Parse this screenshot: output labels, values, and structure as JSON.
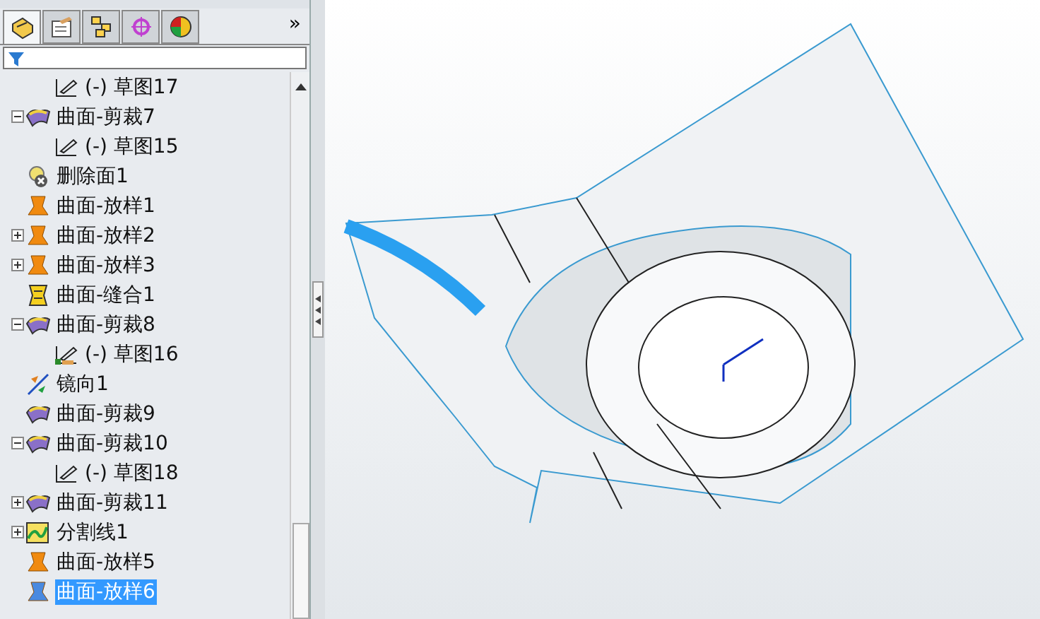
{
  "panel_tabs": [
    {
      "kind": "features",
      "selected": true
    },
    {
      "kind": "properties",
      "selected": false
    },
    {
      "kind": "config",
      "selected": false
    },
    {
      "kind": "dimxpert",
      "selected": false
    },
    {
      "kind": "display",
      "selected": false
    }
  ],
  "more_tabs": "»",
  "tree": [
    {
      "children": [
        {
          "kind": "sketch",
          "label": "(-) 草图17",
          "selected": false
        }
      ]
    },
    {
      "kind": "trim",
      "label": "曲面-剪裁7",
      "expanded": true,
      "selected": false,
      "children": [
        {
          "kind": "sketch",
          "label": "(-) 草图15",
          "selected": false
        }
      ]
    },
    {
      "kind": "delete-face",
      "label": "删除面1",
      "selected": false
    },
    {
      "kind": "loft",
      "label": "曲面-放样1",
      "selected": false
    },
    {
      "kind": "loft",
      "label": "曲面-放样2",
      "expanded": false,
      "selected": false
    },
    {
      "kind": "loft",
      "label": "曲面-放样3",
      "expanded": false,
      "selected": false
    },
    {
      "kind": "knit",
      "label": "曲面-缝合1",
      "selected": false
    },
    {
      "kind": "trim",
      "label": "曲面-剪裁8",
      "expanded": true,
      "selected": false,
      "children": [
        {
          "kind": "sketch-fixed",
          "label": "(-) 草图16",
          "selected": false
        }
      ]
    },
    {
      "kind": "mirror",
      "label": "镜向1",
      "selected": false
    },
    {
      "kind": "trim",
      "label": "曲面-剪裁9",
      "selected": false
    },
    {
      "kind": "trim",
      "label": "曲面-剪裁10",
      "expanded": true,
      "selected": false,
      "children": [
        {
          "kind": "sketch",
          "label": "(-) 草图18",
          "selected": false
        }
      ]
    },
    {
      "kind": "trim",
      "label": "曲面-剪裁11",
      "expanded": false,
      "selected": false
    },
    {
      "kind": "split-line",
      "label": "分割线1",
      "expanded": false,
      "selected": false
    },
    {
      "kind": "loft",
      "label": "曲面-放样5",
      "selected": false
    },
    {
      "kind": "loft-blue",
      "label": "曲面-放样6",
      "selected": true
    }
  ]
}
